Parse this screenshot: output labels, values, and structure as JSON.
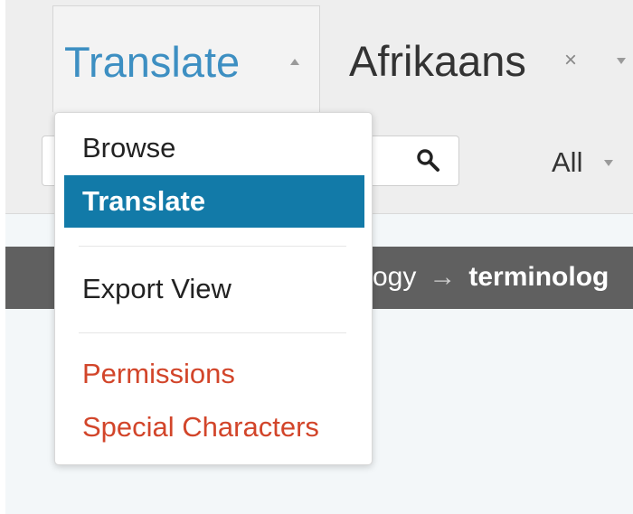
{
  "header": {
    "project_tab_label": "Translate",
    "language_tab_label": "Afrikaans",
    "language_close_glyph": "×",
    "filter_label": "All"
  },
  "search": {
    "value": "",
    "icon": "search-icon"
  },
  "breadcrumb": {
    "parent_text": "ogy",
    "arrow": "→",
    "current_text": "terminolog"
  },
  "menu": {
    "browse": "Browse",
    "translate": "Translate",
    "export_view": "Export View",
    "permissions": "Permissions",
    "special_characters": "Special Characters"
  },
  "colors": {
    "accent": "#127aa8",
    "tab_text": "#3d8fc2",
    "danger_text": "#d2452a",
    "breadcrumb_bg": "#606060"
  }
}
